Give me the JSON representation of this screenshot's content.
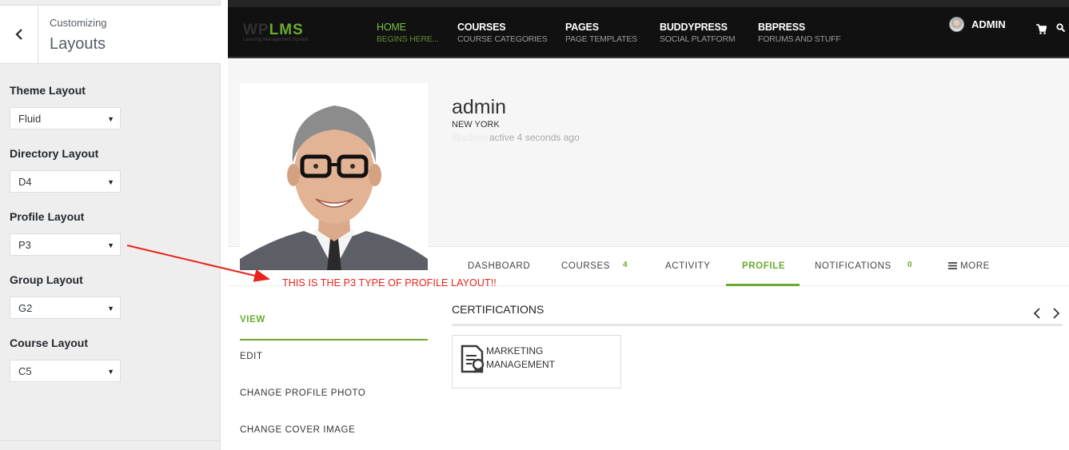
{
  "customizer": {
    "breadcrumb": "Customizing",
    "title": "Layouts",
    "controls": [
      {
        "label": "Theme Layout",
        "value": "Fluid"
      },
      {
        "label": "Directory Layout",
        "value": "D4"
      },
      {
        "label": "Profile Layout",
        "value": "P3"
      },
      {
        "label": "Group Layout",
        "value": "G2"
      },
      {
        "label": "Course Layout",
        "value": "C5"
      }
    ]
  },
  "site": {
    "logo_wp": "WP",
    "logo_lms": "LMS",
    "logo_sub": "Learning Management System",
    "nav": [
      {
        "title": "HOME",
        "sub": "BEGINS HERE..."
      },
      {
        "title": "COURSES",
        "sub": "COURSE CATEGORIES"
      },
      {
        "title": "PAGES",
        "sub": "PAGE TEMPLATES"
      },
      {
        "title": "BUDDYPRESS",
        "sub": "SOCIAL PLATFORM"
      },
      {
        "title": "BBPRESS",
        "sub": "FORUMS AND STUFF"
      }
    ],
    "admin_label": "ADMIN"
  },
  "profile": {
    "name": "admin",
    "location": "NEW YORK",
    "handle": "@admin",
    "activity": "active 4 seconds ago",
    "tabs": [
      {
        "label": "DASHBOARD"
      },
      {
        "label": "COURSES",
        "count": "4"
      },
      {
        "label": "ACTIVITY"
      },
      {
        "label": "PROFILE"
      },
      {
        "label": "NOTIFICATIONS",
        "count": "0"
      },
      {
        "label": "MORE"
      }
    ],
    "subnav": [
      "VIEW",
      "EDIT",
      "CHANGE PROFILE PHOTO",
      "CHANGE COVER IMAGE"
    ]
  },
  "annotation": "THIS IS THE P3 TYPE OF PROFILE LAYOUT!!",
  "certifications": {
    "title": "CERTIFICATIONS",
    "items": [
      {
        "line1": "MARKETING",
        "line2": "MANAGEMENT"
      }
    ]
  },
  "colors": {
    "accent": "#6aaa2e",
    "annotation": "#e8231c",
    "nav_bg": "#111111"
  }
}
